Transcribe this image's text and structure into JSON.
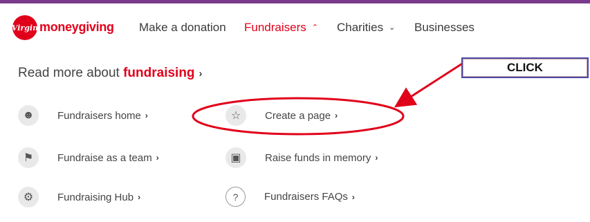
{
  "header": {
    "logo_badge": "Virgin",
    "logo_word": "moneygiving",
    "nav": [
      {
        "label": "Make a donation",
        "icon": ""
      },
      {
        "label": "Fundraisers",
        "icon": "chevron-up-icon"
      },
      {
        "label": "Charities",
        "icon": "chevron-down-icon"
      },
      {
        "label": "Businesses",
        "icon": ""
      }
    ],
    "chevron_up": "⌃",
    "chevron_down": "⌄"
  },
  "heading": {
    "prefix": "Read more about ",
    "keyword": "fundraising",
    "arrow": "›"
  },
  "items": [
    {
      "label": "Fundraisers home",
      "arrow": "›",
      "icon": "people-group-icon"
    },
    {
      "label": "Create a page",
      "arrow": "›",
      "icon": "celebrating-person-icon"
    },
    {
      "label": "Fundraise as a team",
      "arrow": "›",
      "icon": "team-icon"
    },
    {
      "label": "Raise funds in memory",
      "arrow": "›",
      "icon": "memorial-frame-icon"
    },
    {
      "label": "Fundraising Hub",
      "arrow": "›",
      "icon": "hub-icon"
    },
    {
      "label": "Fundraisers FAQs",
      "arrow": "›",
      "icon": "question-icon"
    }
  ],
  "annotation": {
    "callout_text": "CLICK",
    "colors": {
      "ring": "#e1001a",
      "arrow": "#e1001a",
      "callout_border": "#4a4aa3"
    }
  },
  "colors": {
    "brand": "#e1001a",
    "topbar": "#7a3a8c"
  }
}
